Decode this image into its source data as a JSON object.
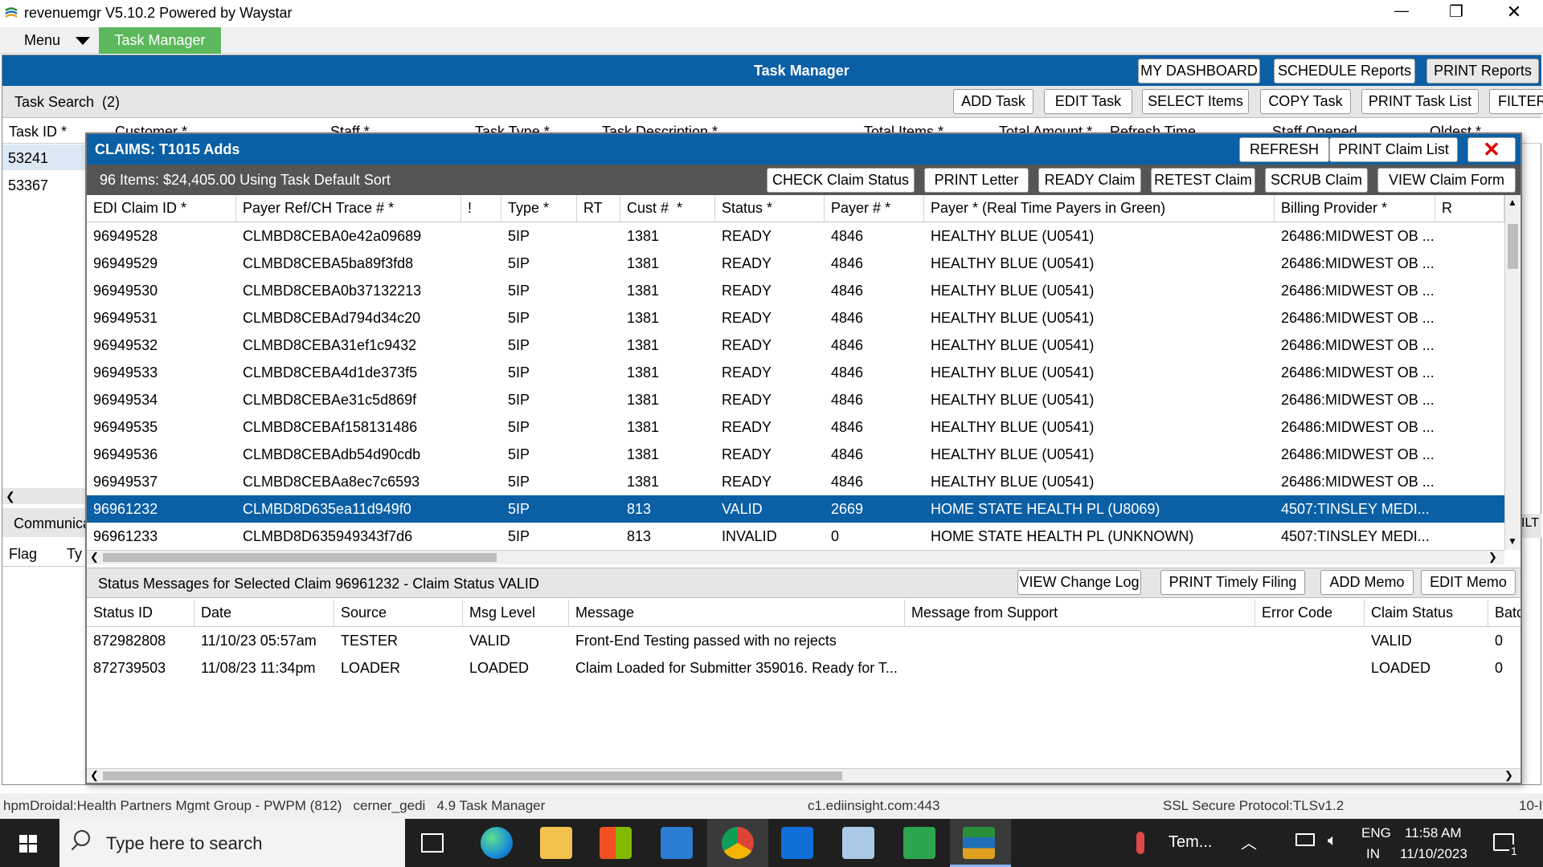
{
  "window": {
    "title": "revenuemgr V5.10.2 Powered by Waystar",
    "minimize": "—",
    "restore": "❐",
    "close": "✕"
  },
  "menubar": {
    "menu_label": "Menu",
    "active_tab": "Task Manager"
  },
  "header": {
    "title": "Task Manager",
    "buttons": [
      "MY DASHBOARD",
      "SCHEDULE Reports",
      "PRINT Reports"
    ]
  },
  "task_search": {
    "label": "Task Search  (2)",
    "buttons": [
      "ADD Task",
      "EDIT Task",
      "SELECT Items",
      "COPY Task",
      "PRINT Task List",
      "FILTER"
    ]
  },
  "background_table": {
    "headers": [
      "Task ID *",
      "Customer *",
      "Staff *",
      "Task Type *",
      "Task Description *",
      "Total Items *",
      "Total Amount *",
      "Refresh Time",
      "Staff Opened",
      "Oldest *"
    ],
    "rows": [
      "53241",
      "53367"
    ],
    "lower_section_label": "Communica",
    "lower_headers": [
      "Flag",
      "Ty"
    ],
    "right_fragment": "ILT"
  },
  "claims": {
    "title": "CLAIMS: T1015 Adds",
    "top_buttons": [
      "REFRESH",
      "PRINT Claim List"
    ],
    "close_label": "✕",
    "summary": "96 Items: $24,405.00 Using Task Default Sort",
    "action_buttons": [
      "CHECK Claim Status",
      "PRINT Letter",
      "READY Claim",
      "RETEST Claim",
      "SCRUB Claim",
      "VIEW Claim Form"
    ],
    "headers": [
      "EDI Claim ID *",
      "Payer Ref/CH Trace # *",
      "!",
      "Type *",
      "RT",
      "Cust #  *",
      "Status *",
      "Payer # *",
      "Payer * (Real Time Payers in Green)",
      "Billing Provider *",
      "R"
    ],
    "rows": [
      [
        "96949528",
        "CLMBD8CEBA0e42a09689",
        "",
        "5IP",
        "",
        "1381",
        "READY",
        "4846",
        "HEALTHY BLUE (U0541)",
        "26486:MIDWEST OB ..."
      ],
      [
        "96949529",
        "CLMBD8CEBA5ba89f3fd8",
        "",
        "5IP",
        "",
        "1381",
        "READY",
        "4846",
        "HEALTHY BLUE (U0541)",
        "26486:MIDWEST OB ..."
      ],
      [
        "96949530",
        "CLMBD8CEBA0b37132213",
        "",
        "5IP",
        "",
        "1381",
        "READY",
        "4846",
        "HEALTHY BLUE (U0541)",
        "26486:MIDWEST OB ..."
      ],
      [
        "96949531",
        "CLMBD8CEBAd794d34c20",
        "",
        "5IP",
        "",
        "1381",
        "READY",
        "4846",
        "HEALTHY BLUE (U0541)",
        "26486:MIDWEST OB ..."
      ],
      [
        "96949532",
        "CLMBD8CEBA31ef1c9432",
        "",
        "5IP",
        "",
        "1381",
        "READY",
        "4846",
        "HEALTHY BLUE (U0541)",
        "26486:MIDWEST OB ..."
      ],
      [
        "96949533",
        "CLMBD8CEBA4d1de373f5",
        "",
        "5IP",
        "",
        "1381",
        "READY",
        "4846",
        "HEALTHY BLUE (U0541)",
        "26486:MIDWEST OB ..."
      ],
      [
        "96949534",
        "CLMBD8CEBAe31c5d869f",
        "",
        "5IP",
        "",
        "1381",
        "READY",
        "4846",
        "HEALTHY BLUE (U0541)",
        "26486:MIDWEST OB ..."
      ],
      [
        "96949535",
        "CLMBD8CEBAf158131486",
        "",
        "5IP",
        "",
        "1381",
        "READY",
        "4846",
        "HEALTHY BLUE (U0541)",
        "26486:MIDWEST OB ..."
      ],
      [
        "96949536",
        "CLMBD8CEBAdb54d90cdb",
        "",
        "5IP",
        "",
        "1381",
        "READY",
        "4846",
        "HEALTHY BLUE (U0541)",
        "26486:MIDWEST OB ..."
      ],
      [
        "96949537",
        "CLMBD8CEBAa8ec7c6593",
        "",
        "5IP",
        "",
        "1381",
        "READY",
        "4846",
        "HEALTHY BLUE (U0541)",
        "26486:MIDWEST OB ..."
      ],
      [
        "96961232",
        "CLMBD8D635ea11d949f0",
        "",
        "5IP",
        "",
        "813",
        "VALID",
        "2669",
        "HOME STATE HEALTH PL (U8069)",
        "4507:TINSLEY MEDI..."
      ],
      [
        "96961233",
        "CLMBD8D635949343f7d6",
        "",
        "5IP",
        "",
        "813",
        "INVALID",
        "0",
        "HOME STATE HEALTH PL (UNKNOWN)",
        "4507:TINSLEY MEDI..."
      ]
    ],
    "selected_row_index": 10
  },
  "status": {
    "title": "Status Messages for Selected Claim 96961232 - Claim Status VALID",
    "buttons": [
      "VIEW Change Log",
      "PRINT Timely Filing",
      "ADD Memo",
      "EDIT Memo"
    ],
    "headers": [
      "Status ID",
      "Date",
      "Source",
      "Msg Level",
      "Message",
      "Message from Support",
      "Error Code",
      "Claim Status",
      "Batc"
    ],
    "rows": [
      [
        "872982808",
        "11/10/23 05:57am",
        "TESTER",
        "VALID",
        "Front-End Testing passed with no rejects",
        "",
        "",
        "VALID",
        "0"
      ],
      [
        "872739503",
        "11/08/23 11:34pm",
        "LOADER",
        "LOADED",
        "Claim Loaded for Submitter 359016. Ready for T...",
        "",
        "",
        "LOADED",
        "0"
      ]
    ]
  },
  "statusbar": {
    "left": "hpmDroidal:Health Partners Mgmt Group - PWPM (812)   cerner_gedi   4.9 Task Manager",
    "center": "c1.ediinsight.com:443",
    "right": "SSL Secure Protocol:TLSv1.2",
    "far_right": "10-I"
  },
  "taskbar": {
    "search_placeholder": "Type here to search",
    "weather": "Tem...",
    "lang_top": "ENG",
    "lang_bottom": "IN",
    "time": "11:58 AM",
    "date": "11/10/2023",
    "notification_count": "1"
  },
  "colors": {
    "header_blue": "#0b5fa5",
    "tab_green": "#5cb85c",
    "close_red": "#e00000"
  }
}
